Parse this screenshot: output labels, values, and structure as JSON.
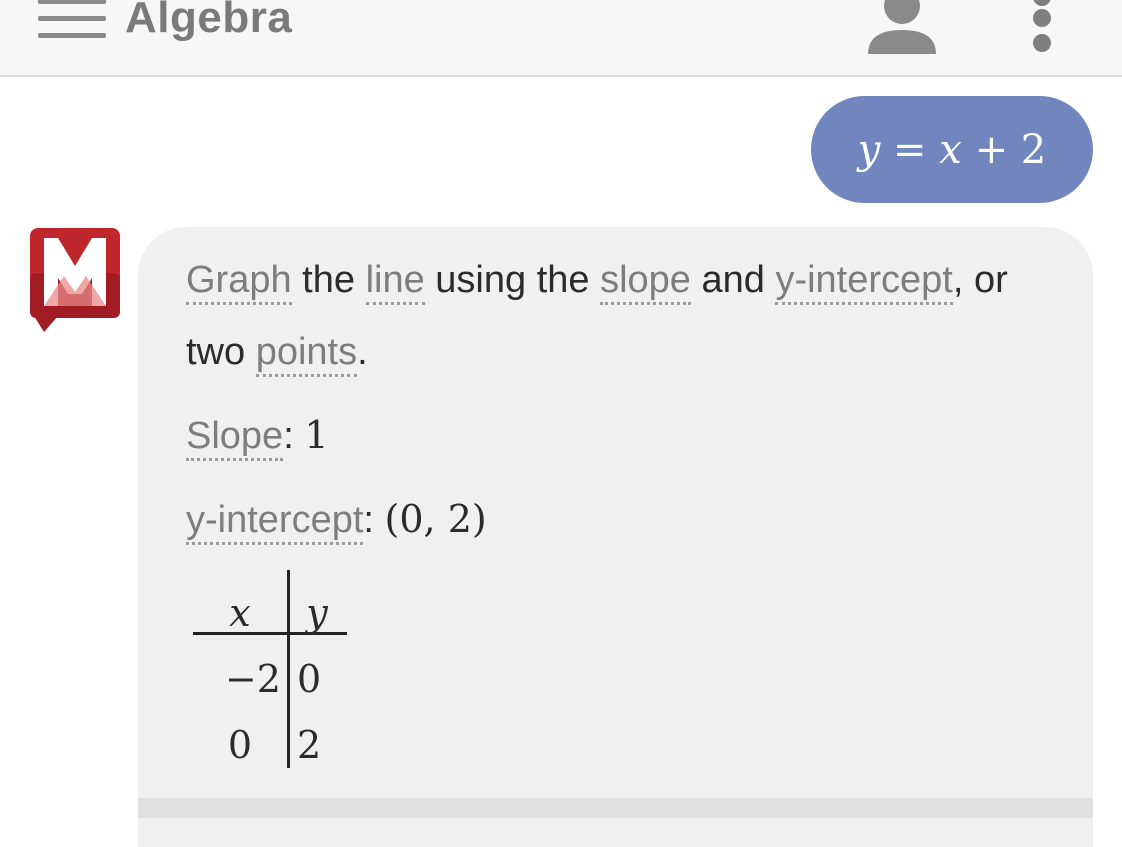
{
  "header": {
    "title": "Algebra"
  },
  "user_message": {
    "lhs": "y",
    "eq": " = ",
    "x": "x",
    "rest": " + 2"
  },
  "answer": {
    "line1": [
      {
        "text": "Graph",
        "term": true
      },
      {
        "text": " the ",
        "term": false
      },
      {
        "text": "line",
        "term": true
      },
      {
        "text": " using the ",
        "term": false
      },
      {
        "text": "slope",
        "term": true
      },
      {
        "text": " and ",
        "term": false
      },
      {
        "text": "y-intercept",
        "term": true
      },
      {
        "text": ", or",
        "term": false
      }
    ],
    "line2_plain": "two ",
    "line2_term": "points",
    "line2_end": ".",
    "slope_label": "Slope",
    "slope_sep": ": ",
    "slope_value": "1",
    "intercept_label": "y-intercept",
    "intercept_sep": ": ",
    "intercept_value": "(0, 2)"
  },
  "table": {
    "headers": [
      "x",
      "y"
    ],
    "rows": [
      [
        "−2",
        "0"
      ],
      [
        "0",
        "2"
      ]
    ]
  },
  "colors": {
    "user_bubble": "#7185be",
    "bot_bubble": "#f0f0f0",
    "logo_red": "#c0272d"
  },
  "icons": [
    "menu-icon",
    "account-icon",
    "more-vert-icon",
    "mathway-logo-icon"
  ]
}
